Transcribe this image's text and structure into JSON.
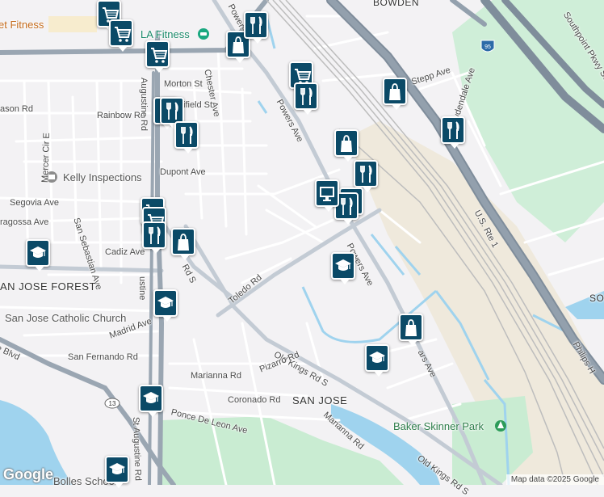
{
  "map": {
    "colors": {
      "land": "#f3f2f4",
      "water": "#9fd3ee",
      "park": "#c9ecd2",
      "industrial": "#efe9dc",
      "highway": "#8a97a4",
      "arterial": "#b8c1cb",
      "road": "#ffffff",
      "rail": "#bdbdbd",
      "pin": "#0b4a67"
    },
    "labels": {
      "bowden": "BOWDEN",
      "fitness_left": "et Fitness",
      "la_fitness": "LA Fitness",
      "powers_top": "Powers",
      "chester": "Chester Ave",
      "morton": "Morton St",
      "ifield": "ifield St",
      "rainbow": "Rainbow Rd",
      "ason": "ason Rd",
      "mercer": "Mercer Cir E",
      "kelly": "Kelly Inspections",
      "dupont": "Dupont Ave",
      "segovia": "Segovia Ave",
      "ragossa": "ragossa Ave",
      "san_sebastian": "San Sebastian Ave",
      "san_jose_forest": "AN JOSE FOREST",
      "cadiz": "Cadiz Ave",
      "augustine": "Augustine Rd",
      "ustine": "ustine",
      "rds": "Rd S",
      "toledo": "Toledo Rd",
      "powers_mid": "Powers Ave",
      "powers_low": "Powers Ave",
      "powers_upper": "Powers Ave",
      "catholic": "San Jose Catholic Church",
      "madrid": "Madrid Ave",
      "blvd": "e Blvd",
      "san_fernando": "San Fernando Rd",
      "old_kings_1": "Old Kings Rd S",
      "old_kings_2": "Old Kings Rd S",
      "pizarro": "Pizarro Rd",
      "marianna_1": "Marianna Rd",
      "marianna_2": "Marianna Rd",
      "coronado": "Coronado Rd",
      "ponce": "Ponce De Leon Ave",
      "san_jose": "SAN JOSE",
      "st_augustine": "St Augustine Rd",
      "baker_skinner": "Baker Skinner Park",
      "bollesschool": "Bolles School",
      "us1": "U.S. Rte 1",
      "philips": "Philips H",
      "southpoint": "Southpoint Pkwy So",
      "stepp": "Stepp Ave",
      "bowdendale": "Bowdendale Ave",
      "sc": "SO",
      "ars_ave": "ars Ave",
      "route_13": "13",
      "route_95": "95"
    },
    "pins": [
      {
        "type": "shopping-cart"
      },
      {
        "type": "shopping-cart"
      },
      {
        "type": "shopping-cart"
      },
      {
        "type": "shopping-cart"
      },
      {
        "type": "shopping-cart"
      },
      {
        "type": "shopping-cart"
      },
      {
        "type": "shopping-bag"
      },
      {
        "type": "shopping-bag"
      },
      {
        "type": "shopping-bag"
      },
      {
        "type": "shopping-bag"
      },
      {
        "type": "shopping-bag"
      },
      {
        "type": "restaurant"
      },
      {
        "type": "restaurant"
      },
      {
        "type": "restaurant"
      },
      {
        "type": "restaurant"
      },
      {
        "type": "restaurant"
      },
      {
        "type": "restaurant"
      },
      {
        "type": "restaurant"
      },
      {
        "type": "restaurant"
      },
      {
        "type": "restaurant"
      },
      {
        "type": "restaurant"
      },
      {
        "type": "school"
      },
      {
        "type": "school"
      },
      {
        "type": "school"
      },
      {
        "type": "school"
      },
      {
        "type": "school"
      },
      {
        "type": "school"
      },
      {
        "type": "monitor"
      }
    ],
    "attribution": "Map data ©2025 Google",
    "logo": "Google"
  }
}
